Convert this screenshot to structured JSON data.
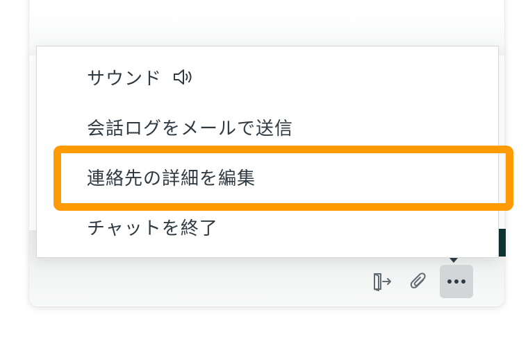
{
  "menu": {
    "items": [
      {
        "label": "サウンド",
        "icon": "speaker-icon"
      },
      {
        "label": "会話ログをメールで送信"
      },
      {
        "label": "連絡先の詳細を編集",
        "highlighted": true
      },
      {
        "label": "チャットを終了"
      }
    ]
  },
  "toolbar": {
    "buttons": [
      {
        "icon": "end-chat-icon"
      },
      {
        "icon": "paperclip-icon"
      },
      {
        "icon": "more-options-icon",
        "active": true
      }
    ]
  },
  "colors": {
    "highlight": "#ff9a00",
    "text": "#2f3941",
    "active_button_bg": "#d2d6d8",
    "accent_dark": "#0f3436"
  }
}
